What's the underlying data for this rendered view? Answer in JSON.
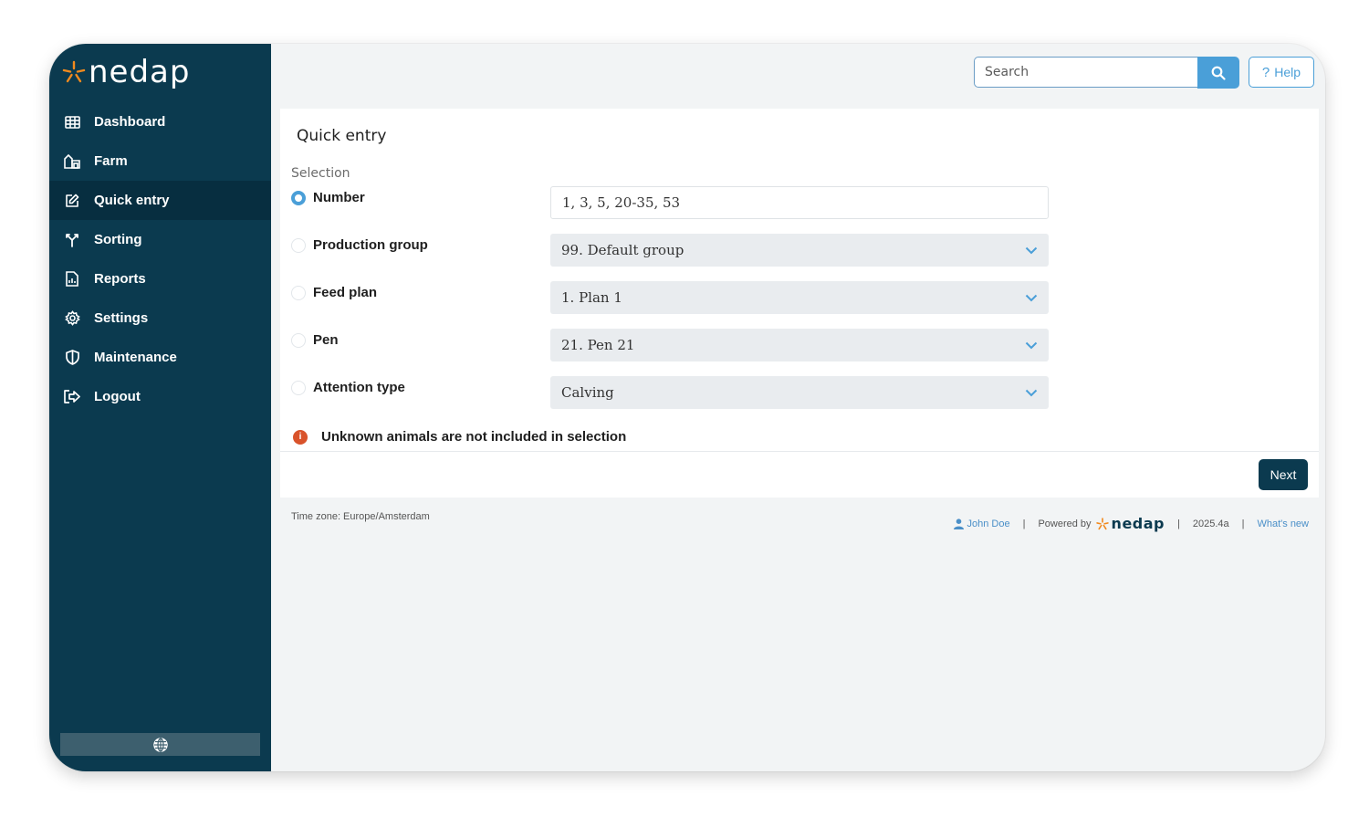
{
  "brand": {
    "name": "nedap"
  },
  "sidebar": {
    "items": [
      {
        "label": "Dashboard",
        "icon": "grid-icon"
      },
      {
        "label": "Farm",
        "icon": "farm-icon"
      },
      {
        "label": "Quick entry",
        "icon": "edit-icon",
        "active": true
      },
      {
        "label": "Sorting",
        "icon": "sort-icon"
      },
      {
        "label": "Reports",
        "icon": "report-icon"
      },
      {
        "label": "Settings",
        "icon": "gear-icon"
      },
      {
        "label": "Maintenance",
        "icon": "shield-icon"
      },
      {
        "label": "Logout",
        "icon": "logout-icon"
      }
    ],
    "language_icon": "globe-icon"
  },
  "topbar": {
    "search_placeholder": "Search",
    "help_label": "Help"
  },
  "card": {
    "title": "Quick entry",
    "selection_label": "Selection",
    "options": [
      {
        "label": "Number",
        "value": "1, 3, 5, 20-35, 53",
        "kind": "input",
        "checked": true
      },
      {
        "label": "Production group",
        "value": "99. Default group",
        "kind": "select",
        "checked": false
      },
      {
        "label": "Feed plan",
        "value": "1. Plan 1",
        "kind": "select",
        "checked": false
      },
      {
        "label": "Pen",
        "value": "21. Pen 21",
        "kind": "select",
        "checked": false
      },
      {
        "label": "Attention type",
        "value": "Calving",
        "kind": "select",
        "checked": false
      }
    ],
    "info_message": "Unknown animals are not included in selection",
    "next_label": "Next"
  },
  "footer": {
    "timezone": "Time zone: Europe/Amsterdam",
    "user": "John Doe",
    "powered_by": "Powered by",
    "powered_brand": "nedap",
    "version": "2025.4a",
    "whats_new": "What's new"
  },
  "colors": {
    "sidebar_bg": "#0b3a4f",
    "accent": "#4a9fd8",
    "logo_orange": "#f28a1e",
    "info_red": "#d9532b"
  }
}
